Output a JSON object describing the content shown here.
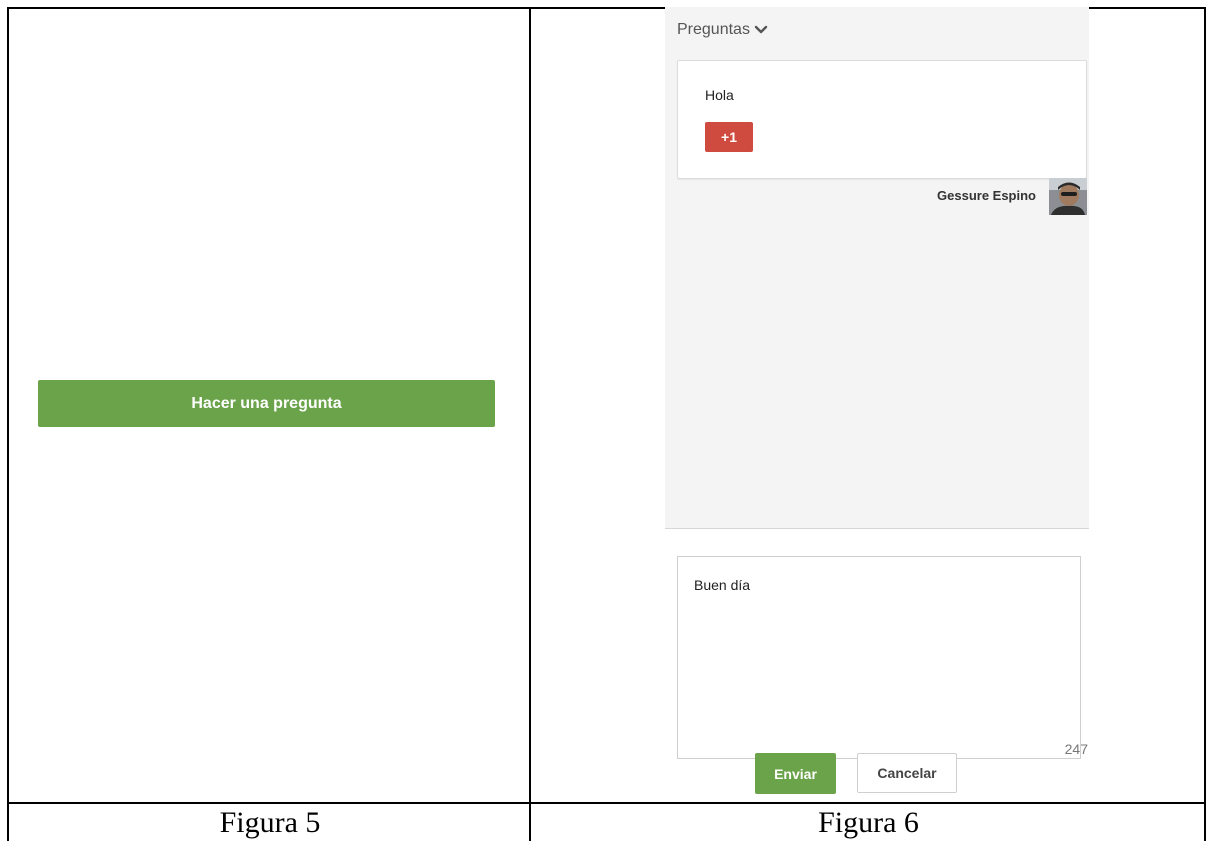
{
  "figura5": {
    "ask_button_label": "Hacer una pregunta",
    "caption": "Figura 5"
  },
  "figura6": {
    "section_title": "Preguntas",
    "question": {
      "text": "Hola",
      "plus_label": "+1",
      "author": "Gessure Espino"
    },
    "answer_input": {
      "value": "Buen día"
    },
    "char_count": "247",
    "send_label": "Enviar",
    "cancel_label": "Cancelar",
    "caption": "Figura 6"
  },
  "colors": {
    "primary_green": "#6aa34a",
    "plus_red": "#cf4b3f",
    "panel_bg": "#f4f4f4"
  },
  "icons": {
    "dropdown": "chevron-down-icon",
    "avatar": "user-avatar"
  }
}
